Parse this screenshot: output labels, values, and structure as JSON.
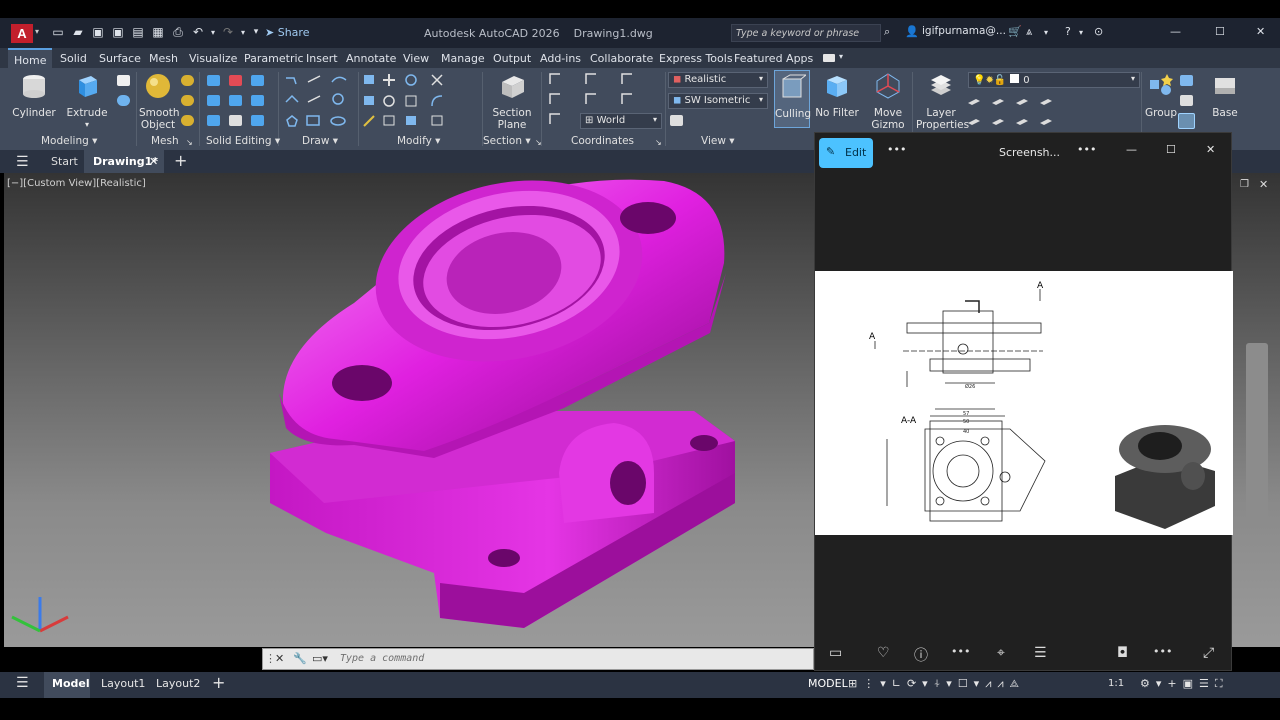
{
  "titlebar": {
    "logo": "A",
    "share": "Share",
    "title": "Autodesk AutoCAD 2026",
    "filename": "Drawing1.dwg",
    "search_placeholder": "Type a keyword or phrase",
    "user": "igifpurnama@..."
  },
  "tabs": [
    "Home",
    "Solid",
    "Surface",
    "Mesh",
    "Visualize",
    "Parametric",
    "Insert",
    "Annotate",
    "View",
    "Manage",
    "Output",
    "Add-ins",
    "Collaborate",
    "Express Tools",
    "Featured Apps"
  ],
  "ribbon": {
    "cylinder": "Cylinder",
    "extrude": "Extrude",
    "smooth1": "Smooth",
    "smooth2": "Object",
    "section1": "Section",
    "section2": "Plane",
    "visual_style": "Realistic",
    "view_dir": "SW Isometric",
    "ucs": "World",
    "culling": "Culling",
    "no_filter": "No Filter",
    "move1": "Move",
    "move2": "Gizmo",
    "layer1": "Layer",
    "layer2": "Properties",
    "layer_value": "0",
    "group": "Group",
    "base": "Base",
    "panels": {
      "modeling": "Modeling",
      "mesh": "Mesh",
      "solid_editing": "Solid Editing",
      "draw": "Draw",
      "modify": "Modify",
      "section": "Section",
      "coordinates": "Coordinates",
      "view": "View"
    }
  },
  "filetabs": {
    "start": "Start",
    "drawing": "Drawing1*"
  },
  "viewport": {
    "label": "[−][Custom View][Realistic]"
  },
  "cmd": {
    "placeholder": "Type a command"
  },
  "status": {
    "model_tab": "Model",
    "layout1": "Layout1",
    "layout2": "Layout2",
    "model": "MODEL",
    "scale": "1:1"
  },
  "photos": {
    "edit": "Edit",
    "title": "Screensh...",
    "drawing_labels": {
      "a_top": "A",
      "a_left": "A",
      "section": "A-A",
      "dim_57": "57",
      "dim_50": "50",
      "dim_40": "40",
      "dim_26": "Ø26"
    }
  },
  "colors": {
    "model": "#e020e0",
    "ribbon": "#414b5c",
    "titlebar": "#1d2330",
    "accent": "#4cc2ff"
  }
}
